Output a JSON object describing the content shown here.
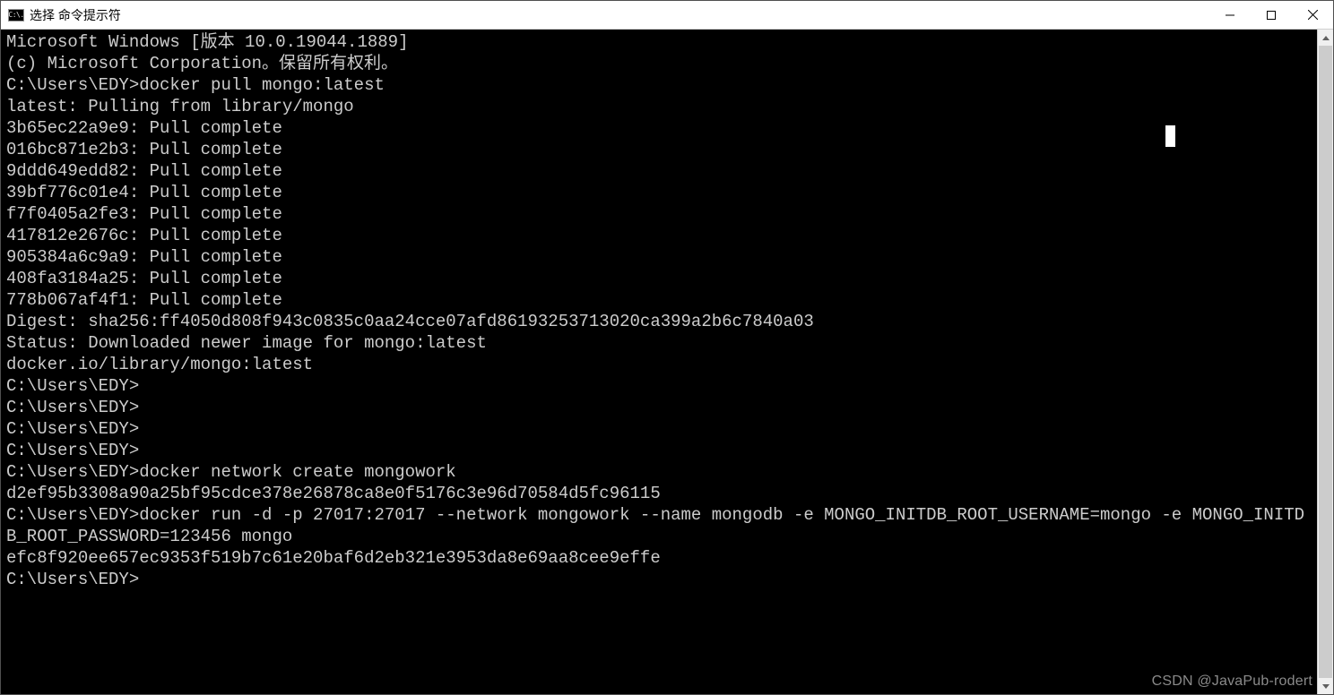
{
  "window": {
    "icon_text": "C:\\.",
    "title": "选择 命令提示符"
  },
  "terminal": {
    "lines": [
      "Microsoft Windows [版本 10.0.19044.1889]",
      "(c) Microsoft Corporation。保留所有权利。",
      "",
      "C:\\Users\\EDY>docker pull mongo:latest",
      "latest: Pulling from library/mongo",
      "3b65ec22a9e9: Pull complete",
      "016bc871e2b3: Pull complete",
      "9ddd649edd82: Pull complete",
      "39bf776c01e4: Pull complete",
      "f7f0405a2fe3: Pull complete",
      "417812e2676c: Pull complete",
      "905384a6c9a9: Pull complete",
      "408fa3184a25: Pull complete",
      "778b067af4f1: Pull complete",
      "Digest: sha256:ff4050d808f943c0835c0aa24cce07afd86193253713020ca399a2b6c7840a03",
      "Status: Downloaded newer image for mongo:latest",
      "docker.io/library/mongo:latest",
      "",
      "C:\\Users\\EDY>",
      "C:\\Users\\EDY>",
      "C:\\Users\\EDY>",
      "C:\\Users\\EDY>",
      "C:\\Users\\EDY>docker network create mongowork",
      "d2ef95b3308a90a25bf95cdce378e26878ca8e0f5176c3e96d70584d5fc96115",
      "",
      "C:\\Users\\EDY>docker run -d -p 27017:27017 --network mongowork --name mongodb -e MONGO_INITDB_ROOT_USERNAME=mongo -e MONGO_INITDB_ROOT_PASSWORD=123456 mongo",
      "efc8f920ee657ec9353f519b7c61e20baf6d2eb321e3953da8e69aa8cee9effe",
      "",
      "C:\\Users\\EDY>"
    ]
  },
  "watermark": "CSDN @JavaPub-rodert"
}
